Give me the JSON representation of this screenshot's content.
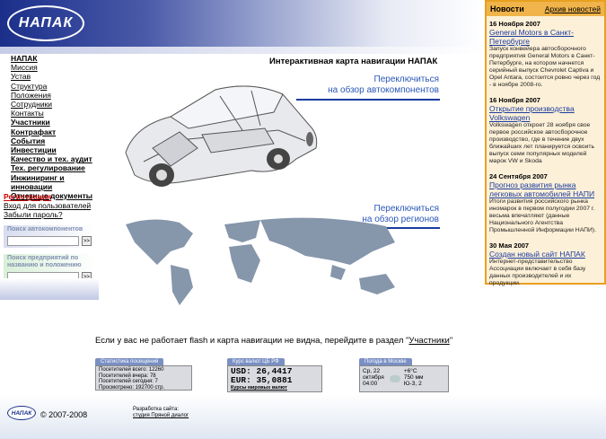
{
  "logo_text": "НАПАК",
  "menu": [
    {
      "label": "НАПАК",
      "bold": true
    },
    {
      "label": "Миссия",
      "bold": false
    },
    {
      "label": "Устав",
      "bold": false
    },
    {
      "label": "Структура",
      "bold": false
    },
    {
      "label": "Положения",
      "bold": false
    },
    {
      "label": "Сотрудники",
      "bold": false
    },
    {
      "label": "Контакты",
      "bold": false
    },
    {
      "label": "Участники",
      "bold": true
    },
    {
      "label": "Контрафакт",
      "bold": true
    },
    {
      "label": "События",
      "bold": true
    },
    {
      "label": "Инвестиции",
      "bold": true
    },
    {
      "label": "Качество и тех. аудит",
      "bold": true
    },
    {
      "label": "Тех. регулирование",
      "bold": true
    },
    {
      "label": "Инжиниринг и инновации",
      "bold": true
    },
    {
      "label": "Отчетные документы",
      "bold": true
    }
  ],
  "aux": {
    "register": "Регистрация",
    "login": "Вход для пользователей",
    "forgot": "Забыли пароль?"
  },
  "search_components": {
    "title": "Поиск автокомпонентов",
    "button": ">>",
    "value": ""
  },
  "search_companies": {
    "title": "Поиск предприятий по названию и положению",
    "button": ">>",
    "value": ""
  },
  "main": {
    "map_title": "Интерактивная карта навигации НАПАК",
    "link_auto_1": "Переключиться",
    "link_auto_2": "на обзор автокомпонентов",
    "link_regions_1": "Переключиться",
    "link_regions_2": "на обзор регионов",
    "flash_note": "Если у вас не работает flash и карта навигации не видна, перейдите в раздел \"",
    "flash_link": "Участники",
    "flash_end": "\""
  },
  "stats": {
    "title": "Статистика посещений",
    "lines": [
      "Посетителей всего: 12260",
      "Посетителей вчера: 78",
      "Посетителей сегодня: 7",
      "Просмотрено: 192700 стр."
    ]
  },
  "currency": {
    "title": "Курс валют ЦБ РФ",
    "usd": "USD: 26,4417",
    "eur": "EUR: 35,0881",
    "footer": "Курсы мировых валют"
  },
  "weather": {
    "title": "Погода в Москве",
    "day": "Ср, 22",
    "month": "октября",
    "time": "04:00",
    "temp": "+6°C",
    "pressure": "750 мм",
    "wind": "Ю-З, 2"
  },
  "news": {
    "title": "Новости",
    "archive": "Архив новостей",
    "items": [
      {
        "date": "16 Ноября 2007",
        "headline": "General Motors в Санкт-Петербурге",
        "body": "Запуск конвейера автосборочного предприятия General Motors в Санкт-Петербурге, на котором начнется серийный выпуск Chevrolet Captiva и Opel Antara, состоится ровно через год - в ноябре 2008-го."
      },
      {
        "date": "16 Ноября 2007",
        "headline": "Открытие производства Volkswagen",
        "body": "Volkswagen откроет 28 ноября свое первое российское автосборочное производство, где в течение двух ближайших лет планируется освоить выпуск семи популярных моделей марок VW и Skoda"
      },
      {
        "date": "24 Сентября 2007",
        "headline": "Прогноз развития рынка легковых автомобилей НАПИ",
        "body": "Итоги развития российского рынка иномарок в первом полугодии 2007 г. весьма впечатляют (данные Национального Агентства Промышленной Информации НАПИ)."
      },
      {
        "date": "30 Мая 2007",
        "headline": "Создан новый сайт НАПАК",
        "body": "Интернет-представительство Ассоциации включает в себя базу данных производителей и их продукции."
      }
    ]
  },
  "footer": {
    "logo": "НАПАК",
    "copyright": "© 2007-2008",
    "dev_label": "Разработка сайта:",
    "dev_link": "студия Пряной диалог"
  }
}
